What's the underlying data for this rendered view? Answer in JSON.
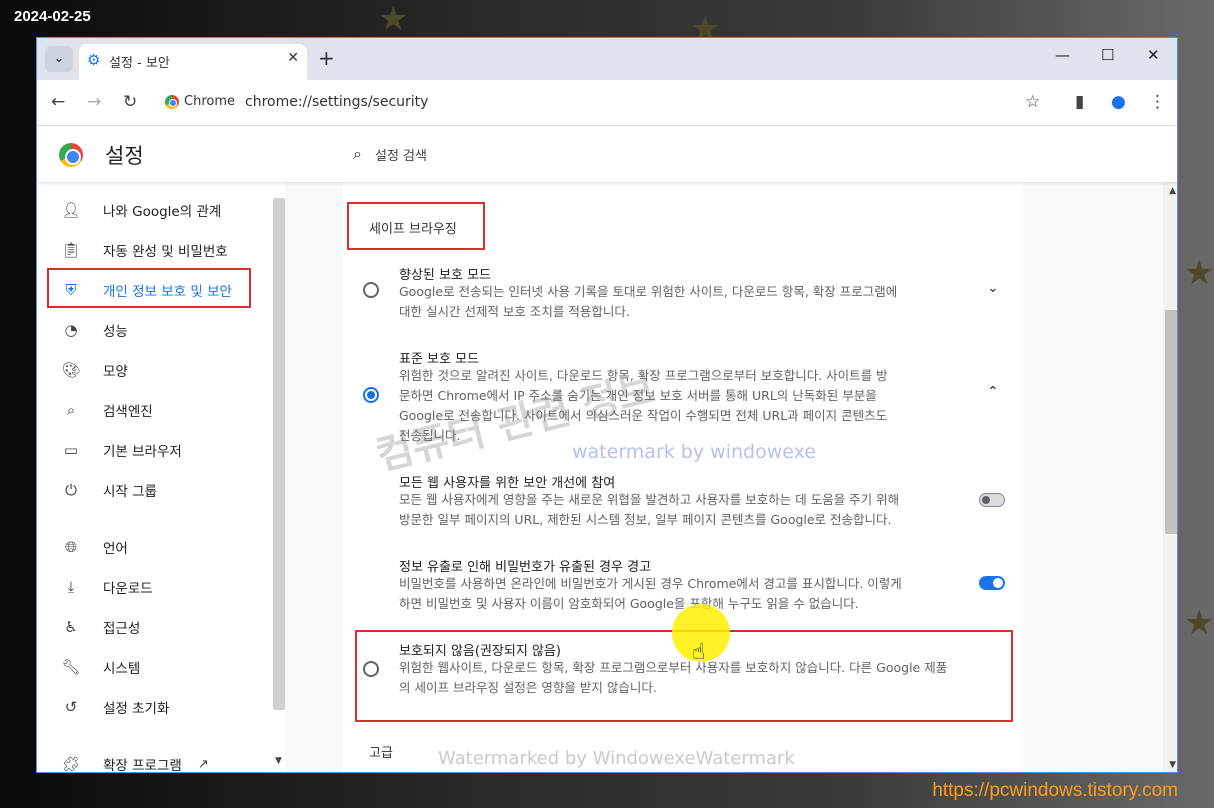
{
  "overlay": {
    "date": "2024-02-25",
    "footer_url": "https://pcwindows.tistory.com",
    "watermark_korean": "컴퓨터 관련 정보",
    "watermark_text": "watermark by windowexe",
    "watermark_bottom": "Watermarked by WindowexeWatermark"
  },
  "browser": {
    "tab_title": "설정 - 보안",
    "omnibox_chip": "Chrome",
    "url": "chrome://settings/security"
  },
  "header": {
    "title": "설정",
    "search_placeholder": "설정 검색"
  },
  "sidebar": {
    "items": [
      {
        "label": "나와 Google의 관계",
        "icon": "person-icon"
      },
      {
        "label": "자동 완성 및 비밀번호",
        "icon": "clipboard-icon"
      },
      {
        "label": "개인 정보 보호 및 보안",
        "icon": "shield-icon",
        "active": true
      },
      {
        "label": "성능",
        "icon": "speedometer-icon"
      },
      {
        "label": "모양",
        "icon": "palette-icon"
      },
      {
        "label": "검색엔진",
        "icon": "search-icon"
      },
      {
        "label": "기본 브라우저",
        "icon": "browser-icon"
      },
      {
        "label": "시작 그룹",
        "icon": "power-icon"
      },
      {
        "label": "언어",
        "icon": "globe-icon"
      },
      {
        "label": "다운로드",
        "icon": "download-icon"
      },
      {
        "label": "접근성",
        "icon": "accessibility-icon"
      },
      {
        "label": "시스템",
        "icon": "wrench-icon"
      },
      {
        "label": "설정 초기화",
        "icon": "history-icon"
      },
      {
        "label": "확장 프로그램",
        "icon": "puzzle-icon"
      }
    ]
  },
  "main": {
    "section_title": "세이프 브라우징",
    "enhanced": {
      "title": "향상된 보호 모드",
      "desc1": "Google로 전송되는 인터넷 사용 기록을 토대로 위험한 사이트, 다운로드 항목, 확장 프로그램에",
      "desc2": "대한 실시간 선제적 보호 조치를 적용합니다."
    },
    "standard": {
      "title": "표준 보호 모드",
      "desc1": "위험한 것으로 알려진 사이트, 다운로드 항목, 확장 프로그램으로부터 보호합니다. 사이트를 방",
      "desc2": "문하면 Chrome에서 IP 주소를 숨기는 개인 정보 보호 서버를 통해 URL의 난독화된 부분을",
      "desc3": "Google로 전송합니다. 사이트에서 의심스러운 작업이 수행되면 전체 URL과 페이지 콘텐츠도",
      "desc4": "전송됩니다."
    },
    "improve": {
      "title": "모든 웹 사용자를 위한 보안 개선에 참여",
      "desc1": "모든 웹 사용자에게 영향을 주는 새로운 위협을 발견하고 사용자를 보호하는 데 도움을 주기 위해",
      "desc2": "방문한 일부 페이지의 URL, 제한된 시스템 정보, 일부 페이지 콘텐츠를 Google로 전송합니다."
    },
    "leak": {
      "title": "정보 유출로 인해 비밀번호가 유출된 경우 경고",
      "desc1": "비밀번호를 사용하면 온라인에 비밀번호가 게시된 경우 Chrome에서 경고를 표시합니다. 이렇게",
      "desc2": "하면 비밀번호 및 사용자 이름이 암호화되어 Google을 포함해 누구도 읽을 수 없습니다."
    },
    "noprotect": {
      "title": "보호되지 않음(권장되지 않음)",
      "desc1": "위험한 웹사이트, 다운로드 항목, 확장 프로그램으로부터 사용자를 보호하지 않습니다. 다른 Google 제품",
      "desc2": "의 세이프 브라우징 설정은 영향을 받지 않습니다."
    },
    "advanced": "고급"
  }
}
